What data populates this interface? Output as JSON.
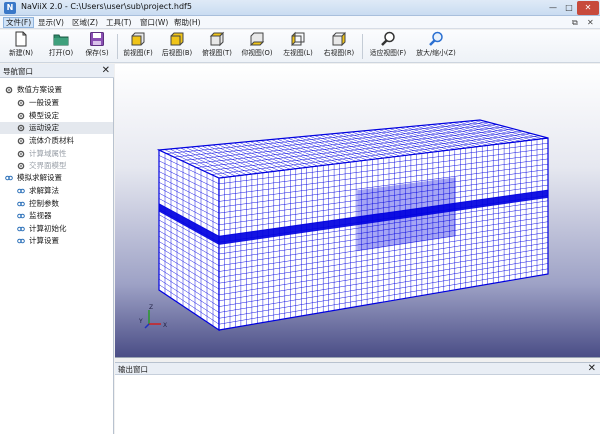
{
  "window": {
    "title": "NaViiX 2.0 - C:\\Users\\user\\sub\\project.hdf5",
    "app_icon_letter": "N",
    "min_glyph": "—",
    "max_glyph": "□",
    "close_glyph": "✕"
  },
  "menu": {
    "items": [
      "文件(F)",
      "显示(V)",
      "区域(Z)",
      "工具(T)",
      "窗口(W)",
      "帮助(H)"
    ],
    "restore_glyph": "⧉",
    "close_glyph": "✕"
  },
  "toolbar": {
    "buttons": [
      {
        "label": "新建(N)",
        "icon": "new-file-icon"
      },
      {
        "label": "打开(O)",
        "icon": "open-folder-icon"
      },
      {
        "label": "保存(S)",
        "icon": "save-icon"
      },
      {
        "label": "前视图(F)",
        "icon": "front-view-icon"
      },
      {
        "label": "后视图(B)",
        "icon": "back-view-icon"
      },
      {
        "label": "俯视图(T)",
        "icon": "top-view-icon"
      },
      {
        "label": "仰视图(O)",
        "icon": "bottom-view-icon"
      },
      {
        "label": "左视图(L)",
        "icon": "left-view-icon"
      },
      {
        "label": "右视图(R)",
        "icon": "right-view-icon"
      },
      {
        "label": "适应视图(F)",
        "icon": "fit-view-icon"
      },
      {
        "label": "放大/缩小(Z)",
        "icon": "zoom-icon"
      }
    ]
  },
  "nav": {
    "title": "导航窗口",
    "close_glyph": "✕",
    "tree": [
      {
        "label": "数值方案设置",
        "level": 0,
        "icon": "gear-icon"
      },
      {
        "label": "一般设置",
        "level": 1,
        "icon": "gear-icon"
      },
      {
        "label": "模型设定",
        "level": 1,
        "icon": "gear-icon"
      },
      {
        "label": "运动设定",
        "level": 1,
        "icon": "gear-icon",
        "selected": true
      },
      {
        "label": "流体介质材料",
        "level": 1,
        "icon": "gear-icon"
      },
      {
        "label": "计算域属性",
        "level": 1,
        "icon": "gear-icon",
        "disabled": true
      },
      {
        "label": "交界面模型",
        "level": 1,
        "icon": "gear-icon",
        "disabled": true
      },
      {
        "label": "模拟求解设置",
        "level": 0,
        "icon": "link-icon"
      },
      {
        "label": "求解算法",
        "level": 1,
        "icon": "link-icon"
      },
      {
        "label": "控制参数",
        "level": 1,
        "icon": "link-icon"
      },
      {
        "label": "监视器",
        "level": 1,
        "icon": "link-icon"
      },
      {
        "label": "计算初始化",
        "level": 1,
        "icon": "link-icon"
      },
      {
        "label": "计算设置",
        "level": 1,
        "icon": "link-icon"
      }
    ]
  },
  "viewport": {
    "mesh_color": "#0000e0",
    "axes": {
      "x": "X",
      "y": "Y",
      "z": "Z"
    }
  },
  "output": {
    "title": "输出窗口",
    "close_glyph": "✕"
  }
}
